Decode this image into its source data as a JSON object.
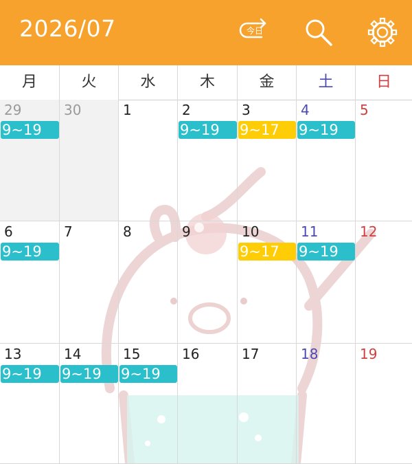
{
  "header": {
    "title": "2026/07",
    "today_label": "今日",
    "background": "#F7A22D",
    "icons": [
      "today-icon",
      "search-icon",
      "gear-icon"
    ]
  },
  "weekdays": [
    "月",
    "火",
    "水",
    "木",
    "金",
    "土",
    "日"
  ],
  "colors": {
    "teal": "#2BBFCB",
    "yellow": "#FFCD05",
    "saturday": "#4a4ab0",
    "sunday": "#d04040"
  },
  "weeks": [
    [
      {
        "day": "29",
        "out": true,
        "event": "9~19",
        "color": "teal"
      },
      {
        "day": "30",
        "out": true
      },
      {
        "day": "1"
      },
      {
        "day": "2",
        "event": "9~19",
        "color": "teal"
      },
      {
        "day": "3",
        "event": "9~17",
        "color": "yellow"
      },
      {
        "day": "4",
        "event": "9~19",
        "color": "teal"
      },
      {
        "day": "5"
      }
    ],
    [
      {
        "day": "6",
        "event": "9~19",
        "color": "teal"
      },
      {
        "day": "7"
      },
      {
        "day": "8"
      },
      {
        "day": "9"
      },
      {
        "day": "10",
        "event": "9~17",
        "color": "yellow"
      },
      {
        "day": "11",
        "event": "9~19",
        "color": "teal"
      },
      {
        "day": "12"
      }
    ],
    [
      {
        "day": "13",
        "event": "9~19",
        "color": "teal"
      },
      {
        "day": "14",
        "event": "9~19",
        "color": "teal"
      },
      {
        "day": "15",
        "event": "9~19",
        "color": "teal"
      },
      {
        "day": "16"
      },
      {
        "day": "17"
      },
      {
        "day": "18"
      },
      {
        "day": "19"
      }
    ]
  ]
}
